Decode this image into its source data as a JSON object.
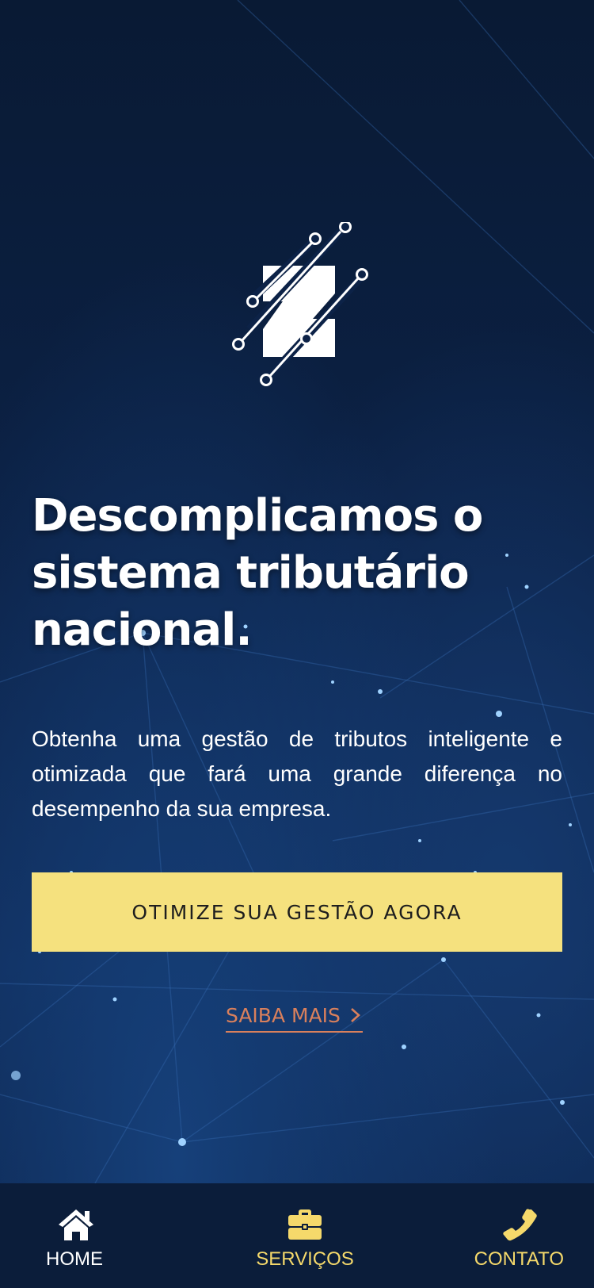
{
  "hero": {
    "headline": "Descomplicamos o sistema tributário nacional.",
    "subtext": "Obtenha uma gestão de tributos inteligente e otimizada que fará uma grande diferença no desempenho da sua empresa.",
    "cta_label": "OTIMIZE SUA GESTÃO AGORA",
    "learn_more_label": "SAIBA MAIS"
  },
  "tabbar": {
    "items": [
      {
        "label": "HOME",
        "icon": "home-icon"
      },
      {
        "label": "SERVIÇOS",
        "icon": "briefcase-icon"
      },
      {
        "label": "CONTATO",
        "icon": "phone-icon"
      }
    ]
  },
  "colors": {
    "background": "#0a1e3c",
    "cta_background": "#f5e17e",
    "learn_more": "#d9805c",
    "tab_active": "#f5d96b"
  }
}
